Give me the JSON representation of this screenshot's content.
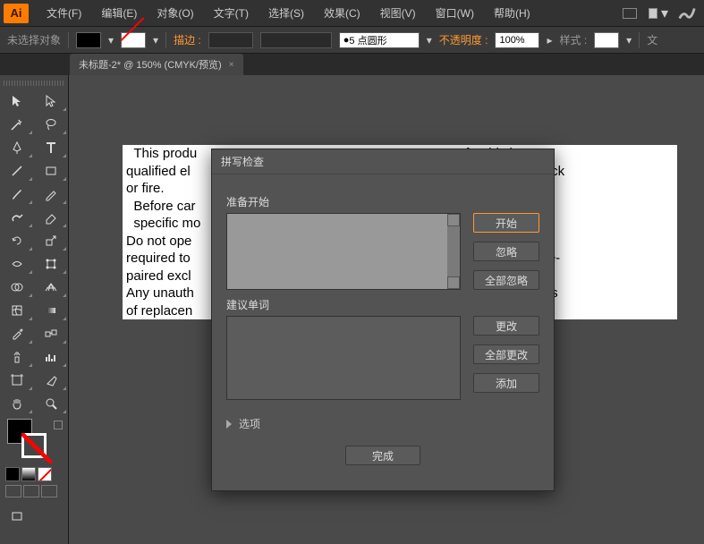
{
  "app": {
    "logo": "Ai"
  },
  "menu": {
    "file": "文件(F)",
    "edit": "编辑(E)",
    "object": "对象(O)",
    "type": "文字(T)",
    "select": "选择(S)",
    "effect": "效果(C)",
    "view": "视图(V)",
    "window": "窗口(W)",
    "help": "帮助(H)"
  },
  "options": {
    "selection_state": "未选择对象",
    "stroke_label": "描边 :",
    "profile_value": "5 点圆形",
    "opacity_label": "不透明度 :",
    "opacity_value": "100%",
    "style_label": "样式 :",
    "doc_label": "文"
  },
  "tab": {
    "title": "未标题-2* @ 150% (CMYK/预览)",
    "close": "×"
  },
  "canvas_text": "  This produ\t\t\t\t\t\t\t\t\t eferably by a\nqualified el\t\t\t\t\t\t\t\t\t k of electric shock\nor fire.\n  Before car\t\t\t\t\t\t\t\t\t e product's\n  specific mo\nDo not ope\t\t\t\t\t\t\t\t\t specifically\nrequired to\t\t\t\t\t\t\t\t\t e opened and re-\npaired excl\t\t\t\t\t\t\t\t\t  .\nAny unauth\t\t\t\t\t\t\t\t\t well as the rights\nof replacen\t\t\t\t\t\t\t\t\t essories.",
  "dialog": {
    "title": "拼写检查",
    "ready_label": "准备开始",
    "suggest_label": "建议单词",
    "options_label": "选项",
    "start": "开始",
    "ignore": "忽略",
    "ignore_all": "全部忽略",
    "change": "更改",
    "change_all": "全部更改",
    "add": "添加",
    "done": "完成"
  }
}
